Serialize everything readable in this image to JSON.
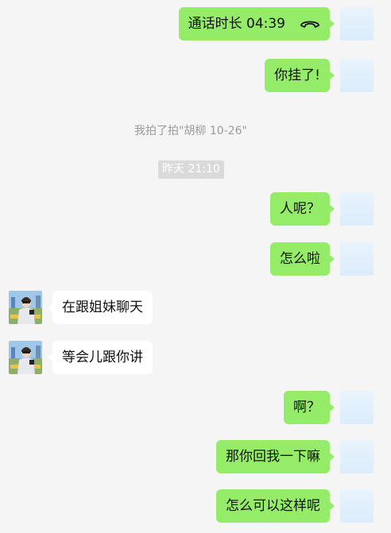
{
  "messages": {
    "call_label": "通话时长 04:39",
    "msg_hung_up": "你挂了!",
    "system_pat": "我拍了拍\"胡柳 10-26\"",
    "timestamp": "昨天 21:10",
    "msg_where": "人呢？",
    "msg_whats_up": "怎么啦",
    "msg_chatting_sisters": "在跟姐妹聊天",
    "msg_tell_later": "等会儿跟你讲",
    "msg_ah": "啊？",
    "msg_reply_me": "那你回我一下嘛",
    "msg_how_could": "怎么可以这样呢"
  },
  "icons": {
    "hangup": "phone-hangup-icon"
  },
  "colors": {
    "my_bubble": "#95ec69",
    "their_bubble": "#ffffff",
    "background": "#f5f5f5"
  }
}
